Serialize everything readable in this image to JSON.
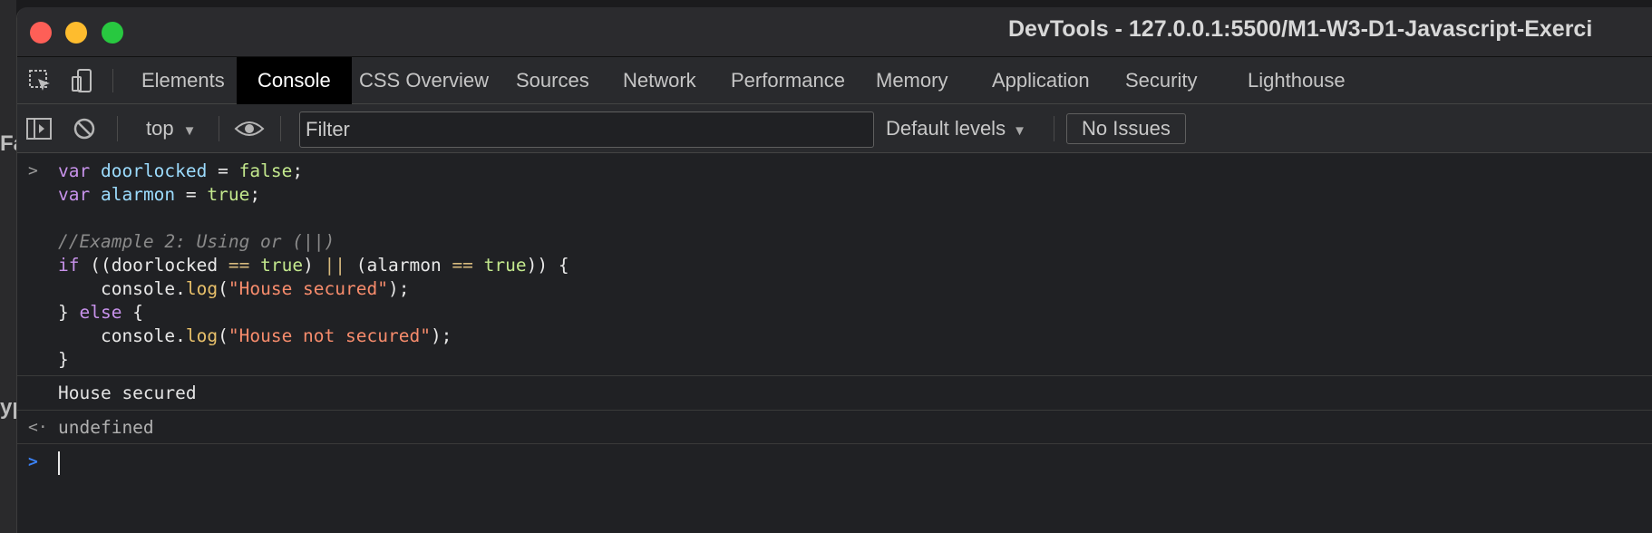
{
  "window": {
    "title": "DevTools - 127.0.0.1:5500/M1-W3-D1-Javascript-Exerci"
  },
  "background": {
    "fragments": [
      "Fa",
      "yp"
    ]
  },
  "toolbar_icons": [
    "inspect-element-icon",
    "device-toolbar-icon"
  ],
  "tabs": [
    {
      "label": "Elements",
      "active": false
    },
    {
      "label": "Console",
      "active": true
    },
    {
      "label": "CSS Overview",
      "active": false
    },
    {
      "label": "Sources",
      "active": false
    },
    {
      "label": "Network",
      "active": false
    },
    {
      "label": "Performance",
      "active": false
    },
    {
      "label": "Memory",
      "active": false
    },
    {
      "label": "Application",
      "active": false
    },
    {
      "label": "Security",
      "active": false
    },
    {
      "label": "Lighthouse",
      "active": false
    }
  ],
  "console_toolbar": {
    "context": "top",
    "filter_placeholder": "Filter",
    "levels": "Default levels",
    "issues": "No Issues"
  },
  "console": {
    "input_code": [
      "var doorlocked = false;",
      "var alarmon = true;",
      "",
      "//Example 2: Using or (||)",
      "if ((doorlocked == true) || (alarmon == true)) {",
      "    console.log(\"House secured\");",
      "} else {",
      "    console.log(\"House not secured\");",
      "}"
    ],
    "output": "House secured",
    "result": "undefined"
  },
  "colors": {
    "accent_prompt": "#3b82f6",
    "close": "#fe5f57",
    "minimize": "#febc2e",
    "maximize": "#28c840"
  }
}
